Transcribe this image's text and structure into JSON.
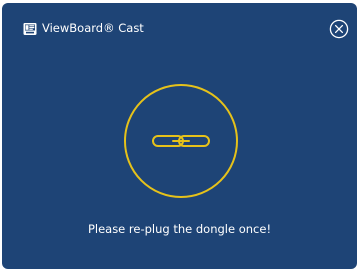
{
  "window": {
    "title": "ViewBoard® Cast",
    "app_icon": "viewboard-cast-icon",
    "close_icon": "close-circle-icon"
  },
  "dialog": {
    "status_icon": "link-chain-icon",
    "message": "Please re-plug the dongle once!"
  },
  "colors": {
    "background": "#1e4476",
    "accent": "#e6c21a",
    "text": "#ffffff"
  }
}
